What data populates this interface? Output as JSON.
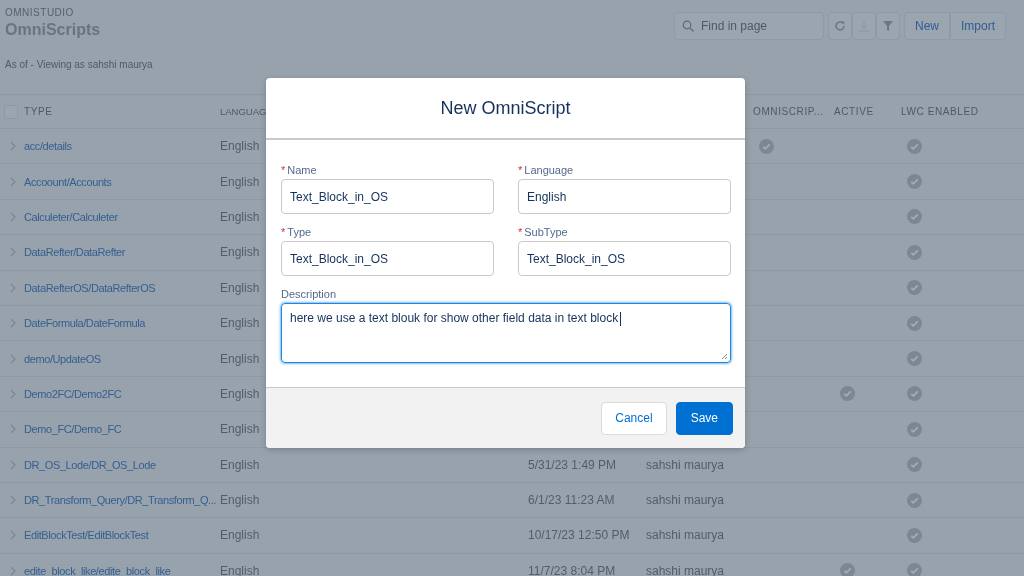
{
  "header": {
    "eyebrow": "OMNISTUDIO",
    "title": "OmniScripts",
    "subtitle": "As of - Viewing as sahshi maurya"
  },
  "toolbar": {
    "search": {
      "placeholder": "Find in page"
    },
    "buttons": [
      {
        "kind": "refresh",
        "disabled": false
      },
      {
        "kind": "download",
        "disabled": true
      },
      {
        "kind": "filter",
        "disabled": false
      }
    ],
    "actions": [
      "New",
      "Import"
    ]
  },
  "table": {
    "select_all_checked": false,
    "columns": [
      "TYPE",
      "LANGUAG",
      "OMNISCRIP...",
      "ACTIVE",
      "LWC ENABLED"
    ],
    "rows": [
      {
        "type": "acc/details",
        "language": "English",
        "omniscript": true,
        "active": false,
        "lwc_enabled": true
      },
      {
        "type": "Accoount/Accounts",
        "language": "English",
        "omniscript": false,
        "active": false,
        "lwc_enabled": true
      },
      {
        "type": "Calculeter/Calculeter",
        "language": "English",
        "omniscript": false,
        "active": false,
        "lwc_enabled": true
      },
      {
        "type": "DataRefter/DataRefter",
        "language": "English",
        "omniscript": false,
        "active": false,
        "lwc_enabled": true
      },
      {
        "type": "DataRefterOS/DataRefterOS",
        "language": "English",
        "omniscript": false,
        "active": false,
        "lwc_enabled": true
      },
      {
        "type": "DateFormula/DateFormula",
        "language": "English",
        "omniscript": false,
        "active": false,
        "lwc_enabled": true
      },
      {
        "type": "demo/UpdateOS",
        "language": "English",
        "omniscript": false,
        "active": false,
        "lwc_enabled": true
      },
      {
        "type": "Demo2FC/Demo2FC",
        "language": "English",
        "omniscript": false,
        "active": true,
        "lwc_enabled": true
      },
      {
        "type": "Demo_FC/Demo_FC",
        "language": "English",
        "omniscript": false,
        "active": false,
        "lwc_enabled": true
      },
      {
        "type": "DR_OS_Lode/DR_OS_Lode",
        "language": "English",
        "date": "5/31/23 1:49 PM",
        "author": "sahshi maurya",
        "omniscript": false,
        "active": false,
        "lwc_enabled": true
      },
      {
        "type": "DR_Transform_Query/DR_Transform_Q...",
        "language": "English",
        "date": "6/1/23 11:23 AM",
        "author": "sahshi maurya",
        "omniscript": false,
        "active": false,
        "lwc_enabled": true
      },
      {
        "type": "EditBlockTest/EditBlockTest",
        "language": "English",
        "date": "10/17/23 12:50 PM",
        "author": "sahshi maurya",
        "omniscript": false,
        "active": false,
        "lwc_enabled": true
      },
      {
        "type": "edite_block_like/edite_block_like",
        "language": "English",
        "date": "11/7/23 8:04 PM",
        "author": "sahshi maurya",
        "omniscript": false,
        "active": true,
        "lwc_enabled": true
      }
    ]
  },
  "modal": {
    "title": "New OmniScript",
    "fields": [
      {
        "label": "Name",
        "required_mark": "*",
        "value": "Text_Block_in_OS"
      },
      {
        "label": "Language",
        "required_mark": "*",
        "value": "English"
      },
      {
        "label": "Type",
        "required_mark": "*",
        "value": "Text_Block_in_OS"
      },
      {
        "label": "SubType",
        "required_mark": "*",
        "value": "Text_Block_in_OS"
      }
    ],
    "description": {
      "label": "Description",
      "value": "here we use a text blouk for show other field data in text block",
      "focused": true
    },
    "buttons": [
      {
        "label": "Cancel",
        "kind": "neutral"
      },
      {
        "label": "Save",
        "kind": "brand"
      }
    ]
  }
}
